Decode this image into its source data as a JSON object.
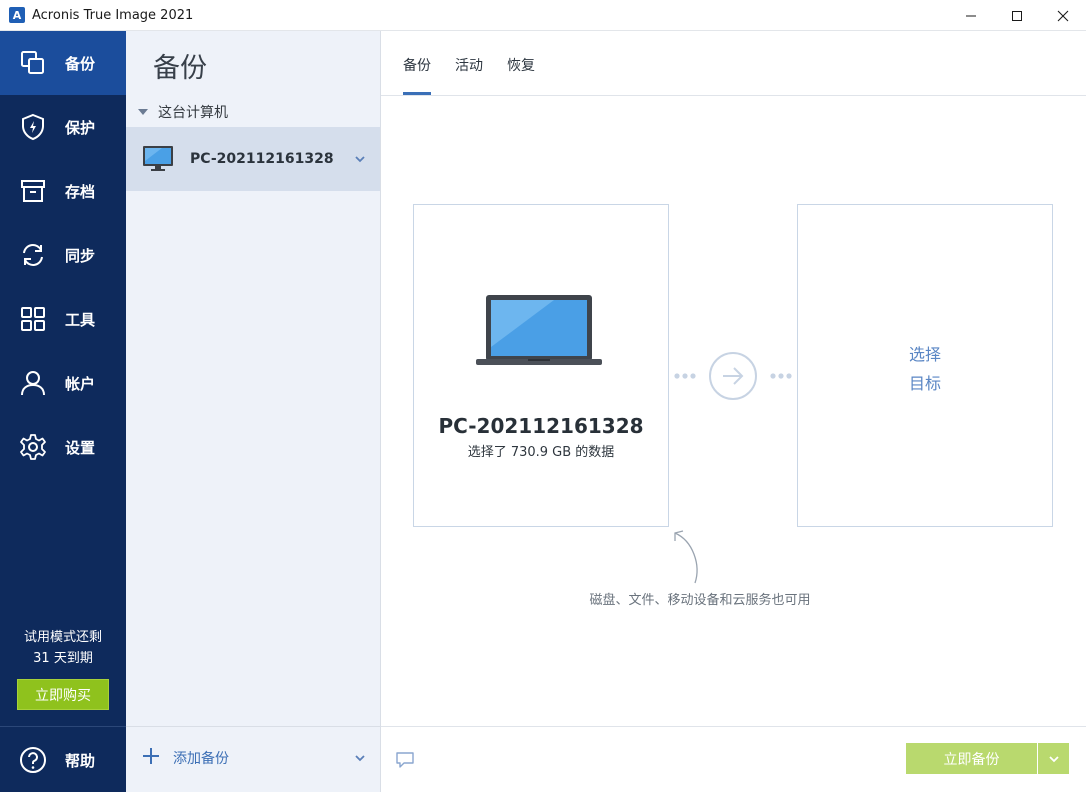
{
  "window": {
    "title": "Acronis True Image 2021",
    "logo_letter": "A"
  },
  "nav": {
    "items": [
      {
        "label": "备份",
        "icon": "backup-icon",
        "active": true
      },
      {
        "label": "保护",
        "icon": "shield-icon",
        "active": false
      },
      {
        "label": "存档",
        "icon": "archive-icon",
        "active": false
      },
      {
        "label": "同步",
        "icon": "sync-icon",
        "active": false
      },
      {
        "label": "工具",
        "icon": "tools-grid-icon",
        "active": false
      },
      {
        "label": "帐户",
        "icon": "account-icon",
        "active": false
      },
      {
        "label": "设置",
        "icon": "gear-icon",
        "active": false
      }
    ],
    "trial_line1": "试用模式还剩",
    "trial_line2": "31 天到期",
    "buy_label": "立即购买",
    "help_label": "帮助"
  },
  "backup_list": {
    "title": "备份",
    "group_label": "这台计算机",
    "item_name": "PC-202112161328",
    "add_label": "添加备份"
  },
  "tabs": [
    {
      "label": "备份",
      "active": true
    },
    {
      "label": "活动",
      "active": false
    },
    {
      "label": "恢复",
      "active": false
    }
  ],
  "source": {
    "name": "PC-202112161328",
    "subtitle": "选择了 730.9 GB 的数据"
  },
  "destination": {
    "line1": "选择",
    "line2": "目标"
  },
  "hint": "磁盘、文件、移动设备和云服务也可用",
  "footer": {
    "backup_now": "立即备份"
  },
  "colors": {
    "nav_bg": "#0e2a5c",
    "nav_active": "#1b4d9c",
    "accent": "#3a6fb7",
    "buy_green": "#8fc21d",
    "backup_green_disabled": "#b9d96e"
  }
}
